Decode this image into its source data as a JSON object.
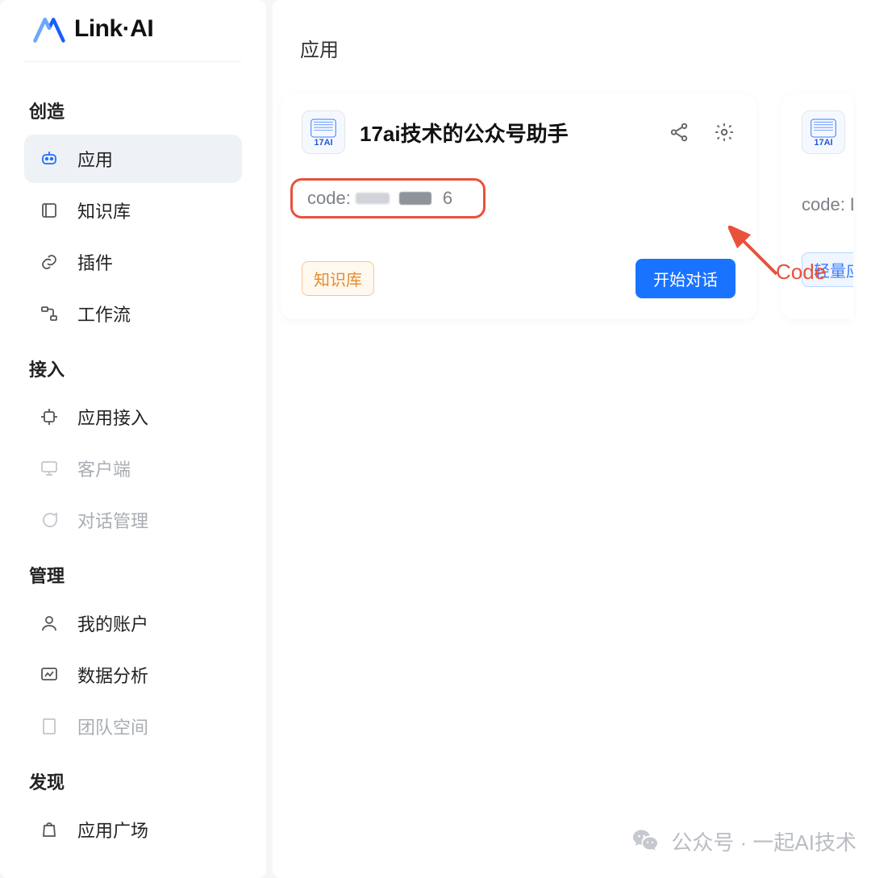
{
  "brand": {
    "name": "Link·AI"
  },
  "sidebar": {
    "sections": [
      {
        "title": "创造",
        "items": [
          {
            "label": "应用",
            "icon": "robot-icon",
            "active": true,
            "muted": false
          },
          {
            "label": "知识库",
            "icon": "book-icon",
            "active": false,
            "muted": false
          },
          {
            "label": "插件",
            "icon": "link-icon",
            "active": false,
            "muted": false
          },
          {
            "label": "工作流",
            "icon": "flow-icon",
            "active": false,
            "muted": false
          }
        ]
      },
      {
        "title": "接入",
        "items": [
          {
            "label": "应用接入",
            "icon": "chip-icon",
            "active": false,
            "muted": false
          },
          {
            "label": "客户端",
            "icon": "monitor-icon",
            "active": false,
            "muted": true
          },
          {
            "label": "对话管理",
            "icon": "chat-icon",
            "active": false,
            "muted": true
          }
        ]
      },
      {
        "title": "管理",
        "items": [
          {
            "label": "我的账户",
            "icon": "user-icon",
            "active": false,
            "muted": false
          },
          {
            "label": "数据分析",
            "icon": "analytics-icon",
            "active": false,
            "muted": false
          },
          {
            "label": "团队空间",
            "icon": "building-icon",
            "active": false,
            "muted": true
          }
        ]
      },
      {
        "title": "发现",
        "items": [
          {
            "label": "应用广场",
            "icon": "bag-icon",
            "active": false,
            "muted": false
          }
        ]
      }
    ]
  },
  "main": {
    "header": "应用",
    "cards": [
      {
        "avatar_label": "17AI",
        "title": "17ai技术的公众号助手",
        "code_prefix": "code:",
        "code_visible_suffix": "6",
        "tag": "知识库",
        "action": "开始对话"
      },
      {
        "avatar_label": "17AI",
        "code_prefix": "code: D",
        "tag": "轻量应用"
      }
    ],
    "annotation": {
      "label": "Code"
    }
  },
  "watermark": {
    "text": "公众号 · 一起AI技术"
  }
}
